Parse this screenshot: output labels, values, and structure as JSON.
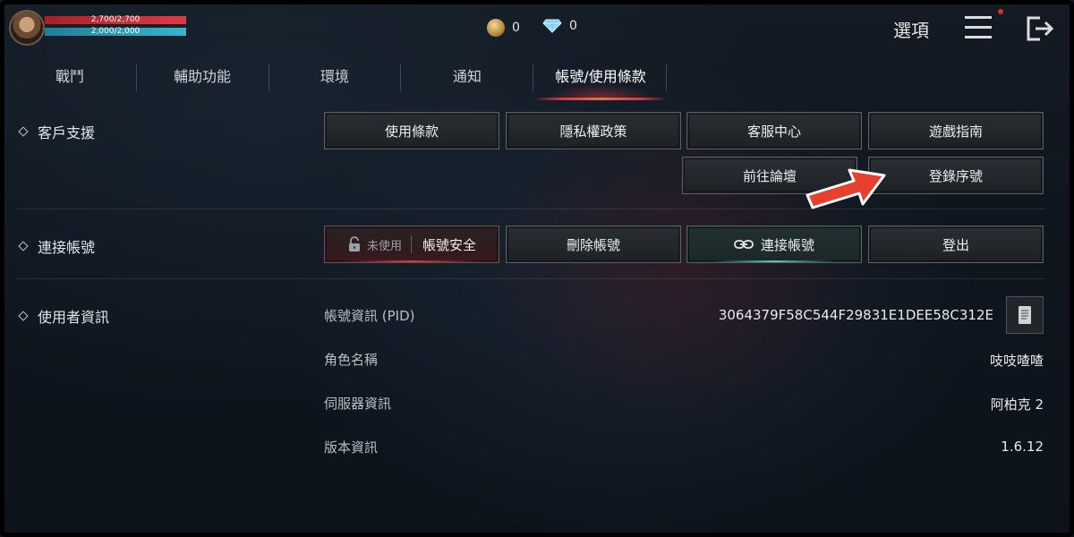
{
  "player": {
    "hp_text": "2,700/2,700",
    "mp_text": "2,000/2,000",
    "hp_fraction": 1.0,
    "mp_fraction": 1.0
  },
  "currency": {
    "coins": "0",
    "gems": "0"
  },
  "header": {
    "options_label": "選項"
  },
  "tabs": [
    {
      "label": "戰鬥"
    },
    {
      "label": "輔助功能"
    },
    {
      "label": "環境"
    },
    {
      "label": "通知"
    },
    {
      "label": "帳號/使用條款",
      "active": true
    }
  ],
  "support": {
    "label": "客戶支援",
    "buttons": [
      "使用條款",
      "隱私權政策",
      "客服中心",
      "遊戲指南",
      "前往論壇",
      "登錄序號"
    ]
  },
  "link_account": {
    "label": "連接帳號",
    "security_status": "未使用",
    "security_label": "帳號安全",
    "delete_label": "刪除帳號",
    "link_label": "連接帳號",
    "logout_label": "登出"
  },
  "user_info": {
    "label": "使用者資訊",
    "rows": [
      {
        "key": "帳號資訊 (PID)",
        "value": "3064379F58C544F29831E1DEE58C312E"
      },
      {
        "key": "角色名稱",
        "value": "吱吱喳喳"
      },
      {
        "key": "伺服器資訊",
        "value": "阿柏克 2"
      },
      {
        "key": "版本資訊",
        "value": "1.6.12"
      }
    ]
  },
  "colors": {
    "accent_red": "#d33a40",
    "accent_teal": "#5fc8bd",
    "hp_bar": "#e03a44",
    "mp_bar": "#37b6d0",
    "arrow": "#e8402e"
  }
}
